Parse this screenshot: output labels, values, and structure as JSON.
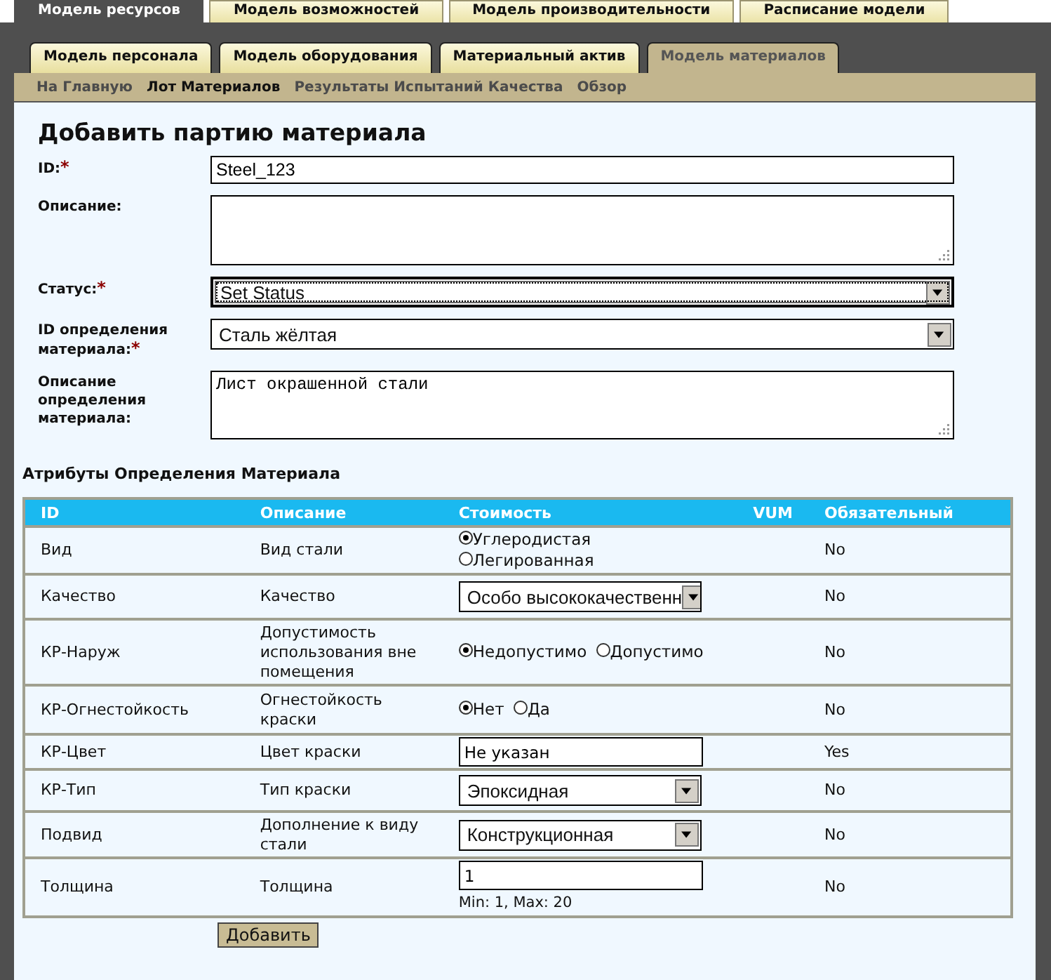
{
  "top_tabs": [
    {
      "label": "Модель ресурсов",
      "selected": true
    },
    {
      "label": "Модель возможностей",
      "selected": false
    },
    {
      "label": "Модель производительности",
      "selected": false
    },
    {
      "label": "Расписание модели",
      "selected": false
    }
  ],
  "sub_tabs": [
    {
      "label": "Модель персонала",
      "selected": false
    },
    {
      "label": "Модель оборудования",
      "selected": false
    },
    {
      "label": "Материальный актив",
      "selected": false
    },
    {
      "label": "Модель материалов",
      "selected": true
    }
  ],
  "nav_links": [
    {
      "label": "На Главную",
      "selected": false
    },
    {
      "label": "Лот Материалов",
      "selected": true
    },
    {
      "label": "Результаты Испытаний Качества",
      "selected": false
    },
    {
      "label": "Обзор",
      "selected": false
    }
  ],
  "form": {
    "title": "Добавить партию материала",
    "fields": [
      {
        "kind": "text",
        "label": "ID:",
        "mark": "*",
        "value": "Steel_123"
      },
      {
        "kind": "textarea",
        "label": "Описание:"
      },
      {
        "kind": "select",
        "label": "Статус:",
        "mark": "*",
        "value": "Set Status",
        "focused": true
      },
      {
        "kind": "select",
        "label": "ID определения материала:",
        "mark": "*",
        "value": "Сталь жёлтая",
        "focused": false
      },
      {
        "kind": "textarea",
        "label": "Описание определения материала:",
        "value": "Лист окрашенной стали"
      }
    ]
  },
  "attributes": {
    "title": "Атрибуты Определения Материала",
    "columns": [
      "ID",
      "Описание",
      "Стоимость",
      "VUM",
      "Обязательный"
    ],
    "rows": [
      {
        "id": "Вид",
        "description": "Вид стали",
        "value": {
          "kind": "radio",
          "options": [
            {
              "label": "Углеродистая",
              "selected": true
            },
            {
              "label": "Легированная",
              "selected": false
            }
          ]
        },
        "required": "No"
      },
      {
        "id": "Качество",
        "description": "Качество",
        "value": {
          "kind": "select",
          "text": "Особо высококачественн"
        },
        "required": "No"
      },
      {
        "id": "КР-Наруж",
        "description": "Допустимость использования вне помещения",
        "value": {
          "kind": "radio",
          "options": [
            {
              "label": "Недопустимо",
              "selected": true
            },
            {
              "label": "Допустимо",
              "selected": false
            }
          ]
        },
        "required": "No"
      },
      {
        "id": "КР-Огнестойкость",
        "description": "Огнестойкость краски",
        "value": {
          "kind": "radio",
          "options": [
            {
              "label": "Нет",
              "selected": true
            },
            {
              "label": "Да",
              "selected": false
            }
          ]
        },
        "required": "No"
      },
      {
        "id": "КР-Цвет",
        "description": "Цвет краски",
        "value": {
          "kind": "text",
          "text": "Не указан"
        },
        "required": "Yes"
      },
      {
        "id": "КР-Тип",
        "description": "Тип краски",
        "value": {
          "kind": "select",
          "text": "Эпоксидная"
        },
        "required": "No"
      },
      {
        "id": "Подвид",
        "description": "Дополнение к виду стали",
        "value": {
          "kind": "select",
          "text": "Конструкционная"
        },
        "required": "No"
      },
      {
        "id": "Толщина",
        "description": "Толщина",
        "value": {
          "kind": "text",
          "text": "1",
          "hint": "Min: 1, Max: 20"
        },
        "required": "No"
      }
    ]
  },
  "submit": "Добавить"
}
